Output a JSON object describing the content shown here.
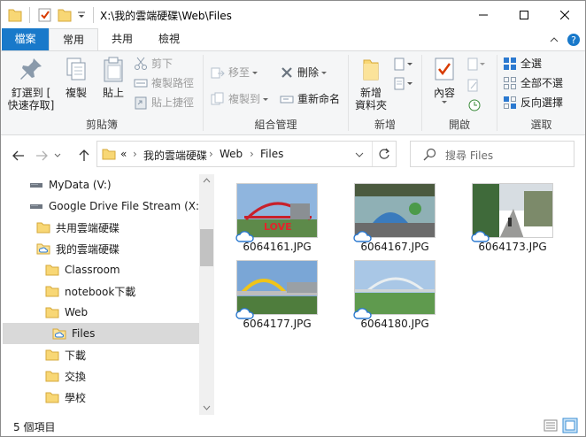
{
  "window": {
    "title": "X:\\我的雲端硬碟\\Web\\Files"
  },
  "ribbon_tabs": [
    "檔案",
    "常用",
    "共用",
    "檢視"
  ],
  "clipboard": {
    "pin_label": "釘選到 [\n快速存取]",
    "copy_label": "複製",
    "paste_label": "貼上",
    "cut_label": "剪下",
    "copy_path_label": "複製路徑",
    "paste_shortcut_label": "貼上捷徑",
    "group_label": "剪貼簿"
  },
  "organize": {
    "move_to_label": "移至",
    "copy_to_label": "複製到",
    "delete_label": "刪除",
    "rename_label": "重新命名",
    "group_label": "組合管理"
  },
  "new_group": {
    "new_folder_label": "新增\n資料夾",
    "group_label": "新增"
  },
  "open_group": {
    "properties_label": "內容",
    "group_label": "開啟"
  },
  "select_group": {
    "select_all_label": "全選",
    "select_none_label": "全部不選",
    "invert_label": "反向選擇",
    "group_label": "選取"
  },
  "address": {
    "overflow": "«",
    "crumbs": [
      "我的雲端硬碟",
      "Web",
      "Files"
    ]
  },
  "search": {
    "placeholder": "搜尋 Files"
  },
  "tree": [
    {
      "label": "MyData (V:)",
      "icon": "drive-icon"
    },
    {
      "label": "Google Drive File Stream (X:)",
      "icon": "drive-icon"
    },
    {
      "label": "共用雲端硬碟",
      "icon": "folder-icon"
    },
    {
      "label": "我的雲端硬碟",
      "icon": "cloud-folder-icon"
    },
    {
      "label": "Classroom",
      "icon": "folder-icon"
    },
    {
      "label": "notebook下載",
      "icon": "folder-icon"
    },
    {
      "label": "Web",
      "icon": "folder-icon"
    },
    {
      "label": "Files",
      "icon": "cloud-folder-icon",
      "selected": true
    },
    {
      "label": "下載",
      "icon": "folder-icon"
    },
    {
      "label": "交換",
      "icon": "folder-icon"
    },
    {
      "label": "學校",
      "icon": "folder-icon"
    }
  ],
  "files": [
    {
      "name": "6064161.JPG"
    },
    {
      "name": "6064167.JPG"
    },
    {
      "name": "6064173.JPG"
    },
    {
      "name": "6064177.JPG"
    },
    {
      "name": "6064180.JPG"
    }
  ],
  "status": {
    "count_text": "5 個項目"
  },
  "colors": {
    "file_tab": "#1979ca",
    "folder_yellow": "#f8d775",
    "selection": "#d9d9d9"
  }
}
